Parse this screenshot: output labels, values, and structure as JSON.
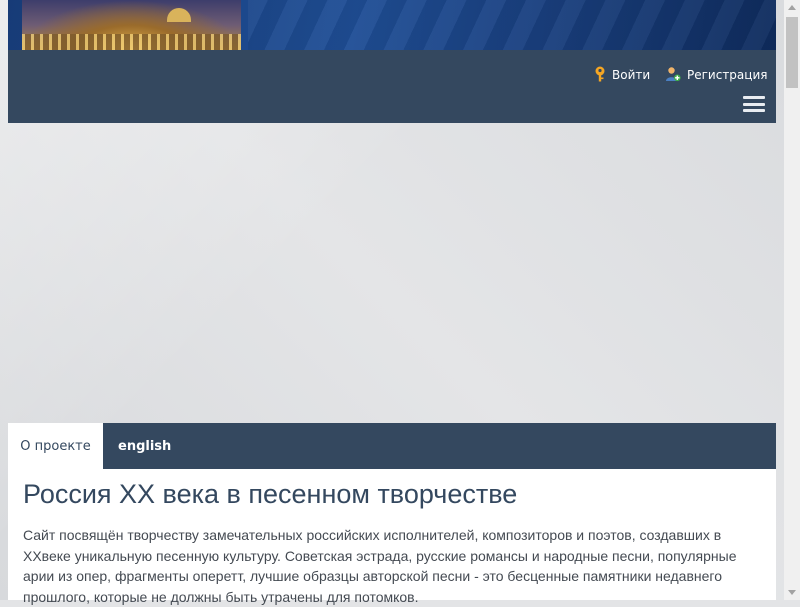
{
  "header": {
    "nav": {
      "login_label": "Войти",
      "register_label": "Регистрация",
      "login_icon": "key-icon",
      "register_icon": "user-add-icon",
      "menu_icon": "hamburger-icon"
    }
  },
  "tabs": [
    {
      "label": "О проекте",
      "active": true
    },
    {
      "label": "english",
      "active": false
    }
  ],
  "main": {
    "title": "Россия ХХ века в песенном творчестве",
    "intro": "Сайт посвящён творчеству замечательных российских исполнителей, композиторов и поэтов, создавших в ХХвеке уникальную песенную культуру. Советская эстрада, русские романсы и народные песни, популярные арии из опер, фрагменты оперетт, лучшие образцы авторской песни - это бесценные памятники недавнего прошлого, которые не должны быть утрачены для потомков."
  },
  "colors": {
    "navbar": "#34485f",
    "icon_accent": "#f5a623",
    "page_background": "#e3e4e6"
  }
}
